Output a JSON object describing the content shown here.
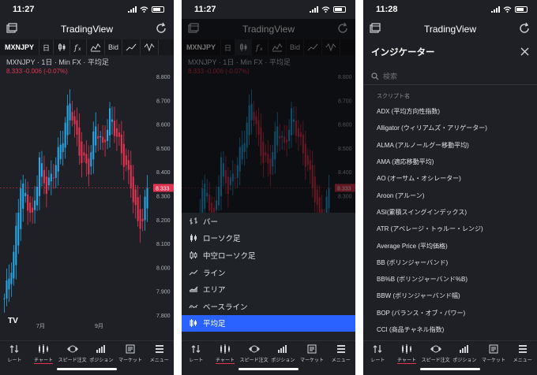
{
  "status": {
    "time1": "11:27",
    "time2": "11:27",
    "time3": "11:28"
  },
  "app": {
    "title": "TradingView"
  },
  "toolbar": {
    "symbol": "MXNJPY",
    "interval": "日",
    "price_type": "Bid"
  },
  "legend": {
    "title": "MXNJPY · 1日 · Min FX · 平均足",
    "change": "8.333 -0.006 (-0.07%)"
  },
  "chart_data": {
    "type": "candlestick",
    "y_ticks": [
      "8.800",
      "8.700",
      "8.600",
      "8.500",
      "8.400",
      "8.300",
      "8.200",
      "8.100",
      "8.000",
      "7.900",
      "7.800"
    ],
    "x_ticks": [
      "7月",
      "9月"
    ],
    "last_price": "8.333",
    "ylim": [
      7.76,
      8.83
    ],
    "colors": {
      "up": "#26a8e8",
      "down": "#e23451"
    }
  },
  "chart_type_menu": {
    "items": [
      {
        "label": "バー",
        "icon": "bar-chart-icon"
      },
      {
        "label": "ローソク足",
        "icon": "candlestick-icon"
      },
      {
        "label": "中空ローソク足",
        "icon": "hollow-candle-icon"
      },
      {
        "label": "ライン",
        "icon": "line-chart-icon"
      },
      {
        "label": "エリア",
        "icon": "area-chart-icon"
      },
      {
        "label": "ベースライン",
        "icon": "baseline-chart-icon"
      },
      {
        "label": "平均足",
        "icon": "heikin-ashi-icon"
      }
    ],
    "selected": "平均足"
  },
  "indicators": {
    "title": "インジケーター",
    "search_placeholder": "検索",
    "section": "スクリプト名",
    "items": [
      "ADX (平均方向性指数)",
      "Alligator (ウィリアムズ・アリゲーター)",
      "ALMA (アルノールグー移動平均)",
      "AMA (適応移動平均)",
      "AO (オーサム・オシレーター)",
      "Aroon (アルーン)",
      "ASI(累積スイングインデックス)",
      "ATR (アベレージ・トゥルー・レンジ)",
      "Average Price (平均価格)",
      "BB (ボリンジャーバンド)",
      "BB%B (ボリンジャーバンド%B)",
      "BBW (ボリンジャーバンド幅)",
      "BOP (バランス・オブ・パワー)",
      "CCI (商品チャネル指数)"
    ]
  },
  "nav": {
    "items": [
      {
        "label": "レート",
        "icon": "rate-arrows-icon"
      },
      {
        "label": "チャート",
        "icon": "chart-icon"
      },
      {
        "label": "スピード注文",
        "icon": "speed-order-icon"
      },
      {
        "label": "ポジション",
        "icon": "position-icon"
      },
      {
        "label": "マーケット",
        "icon": "market-icon"
      },
      {
        "label": "メニュー",
        "icon": "menu-icon"
      }
    ],
    "active": "チャート"
  }
}
